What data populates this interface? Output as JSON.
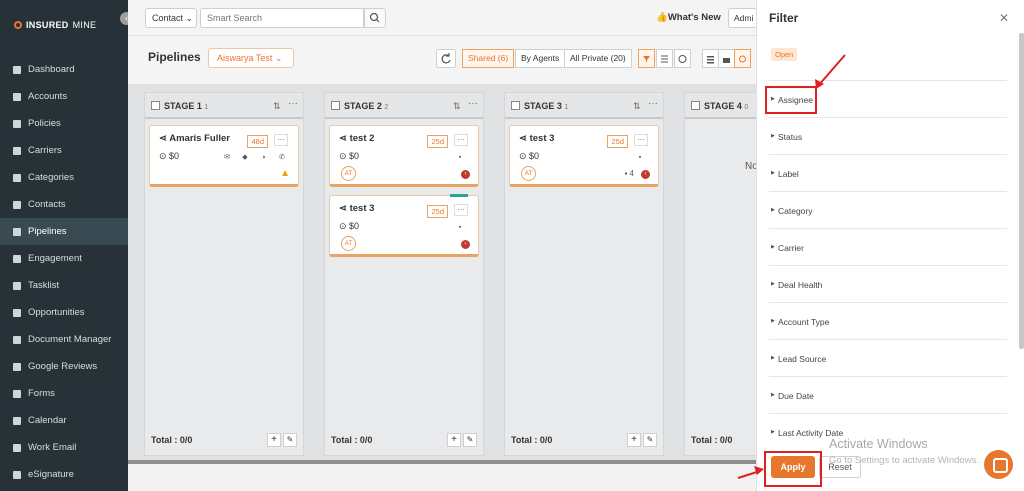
{
  "brand": {
    "name_a": "INSURED",
    "name_b": "MINE"
  },
  "sidebar": {
    "collapse_icon": "chevron-left-icon",
    "items": [
      {
        "label": "Dashboard",
        "icon": "dashboard-icon"
      },
      {
        "label": "Accounts",
        "icon": "users-icon"
      },
      {
        "label": "Policies",
        "icon": "document-icon"
      },
      {
        "label": "Carriers",
        "icon": "building-icon"
      },
      {
        "label": "Categories",
        "icon": "tag-icon"
      },
      {
        "label": "Contacts",
        "icon": "contact-icon"
      },
      {
        "label": "Pipelines",
        "icon": "filter-icon",
        "active": true
      },
      {
        "label": "Engagement",
        "icon": "megaphone-icon"
      },
      {
        "label": "Tasklist",
        "icon": "list-icon"
      },
      {
        "label": "Opportunities",
        "icon": "chart-icon"
      },
      {
        "label": "Document Manager",
        "icon": "folder-icon"
      },
      {
        "label": "Google Reviews",
        "icon": "google-icon"
      },
      {
        "label": "Forms",
        "icon": "form-icon"
      },
      {
        "label": "Calendar",
        "icon": "calendar-icon"
      },
      {
        "label": "Work Email",
        "icon": "mail-icon"
      },
      {
        "label": "eSignature",
        "icon": "signature-icon"
      }
    ]
  },
  "topbar": {
    "contact_select": "Contact",
    "search_placeholder": "Smart Search",
    "whats_new": "What's New",
    "admin": "Admi"
  },
  "pipeline": {
    "title": "Pipelines",
    "selected": "Aiswarya Test",
    "shared": "Shared (6)",
    "by_agents": "By Agents",
    "all_private": "All Private (20)"
  },
  "columns": [
    {
      "title": "STAGE 1",
      "count": "1",
      "total": "Total : 0/0",
      "cards": [
        {
          "name": "Amaris Fuller",
          "value": "$0",
          "days": "48d",
          "warn": true
        }
      ]
    },
    {
      "title": "STAGE 2",
      "count": "2",
      "total": "Total : 0/0",
      "cards": [
        {
          "name": "test 2",
          "value": "$0",
          "days": "25d",
          "avatar": "AT"
        },
        {
          "name": "test 3",
          "value": "$0",
          "days": "25d",
          "avatar": "AT"
        }
      ]
    },
    {
      "title": "STAGE 3",
      "count": "1",
      "total": "Total : 0/0",
      "cards": [
        {
          "name": "test 3",
          "value": "$0",
          "days": "25d",
          "avatar": "AT",
          "count": "4"
        }
      ]
    },
    {
      "title": "STAGE 4",
      "count": "0",
      "total": "Total : 0/0",
      "empty": "No"
    }
  ],
  "filter": {
    "title": "Filter",
    "close_icon": "close-icon",
    "tag": "Open",
    "items": [
      "Assignee",
      "Status",
      "Label",
      "Category",
      "Carrier",
      "Deal Health",
      "Account Type",
      "Lead Source",
      "Due Date",
      "Last Activity Date"
    ],
    "apply": "Apply",
    "reset": "Reset"
  },
  "watermark": {
    "title": "Activate Windows",
    "subtitle": "Go to Settings to activate Windows."
  },
  "colors": {
    "accent": "#e8772e",
    "sidebar": "#263238",
    "annotation": "#e02020"
  }
}
